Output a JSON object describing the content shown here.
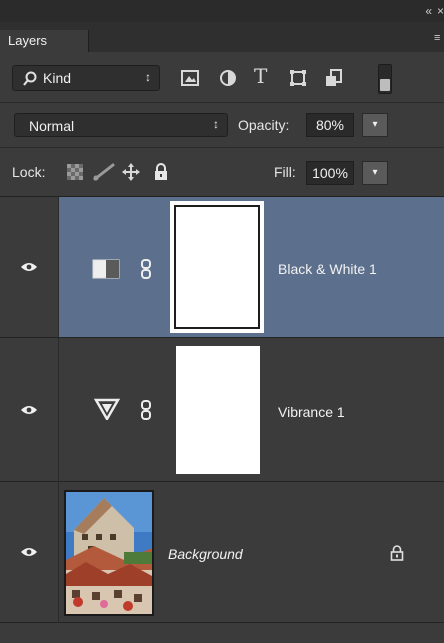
{
  "panel": {
    "tab_label": "Layers",
    "collapse_glyph": "«",
    "close_glyph": "×",
    "menu_glyph": "≡"
  },
  "filter": {
    "kind_label": "Kind",
    "arrows": "↕",
    "icons": [
      "image-filter-icon",
      "adjustment-filter-icon",
      "type-filter-icon",
      "shape-filter-icon",
      "smart-object-filter-icon"
    ],
    "type_glyph": "T",
    "filter_toggle": "on"
  },
  "blend": {
    "mode": "Normal",
    "arrows": "↕",
    "opacity_label": "Opacity:",
    "opacity_value": "80%",
    "dropdown_glyph": "▾"
  },
  "lock": {
    "label": "Lock:",
    "icons": [
      "lock-transparent-pixels-icon",
      "lock-image-pixels-icon",
      "lock-position-icon",
      "lock-all-icon"
    ],
    "fill_label": "Fill:",
    "fill_value": "100%",
    "dropdown_glyph": "▾"
  },
  "layers": [
    {
      "name": "Black & White 1",
      "type": "adjustment",
      "adjustment_icon": "black-white-icon",
      "selected": true,
      "visible": true
    },
    {
      "name": "Vibrance 1",
      "type": "adjustment",
      "adjustment_icon": "vibrance-icon",
      "selected": false,
      "visible": true
    },
    {
      "name": "Background",
      "type": "image",
      "locked": true,
      "visible": true
    }
  ],
  "colors": {
    "panel_bg": "#3b3b3b",
    "selected_row": "#5c6f8d",
    "dark_field": "#2a2a2a"
  }
}
